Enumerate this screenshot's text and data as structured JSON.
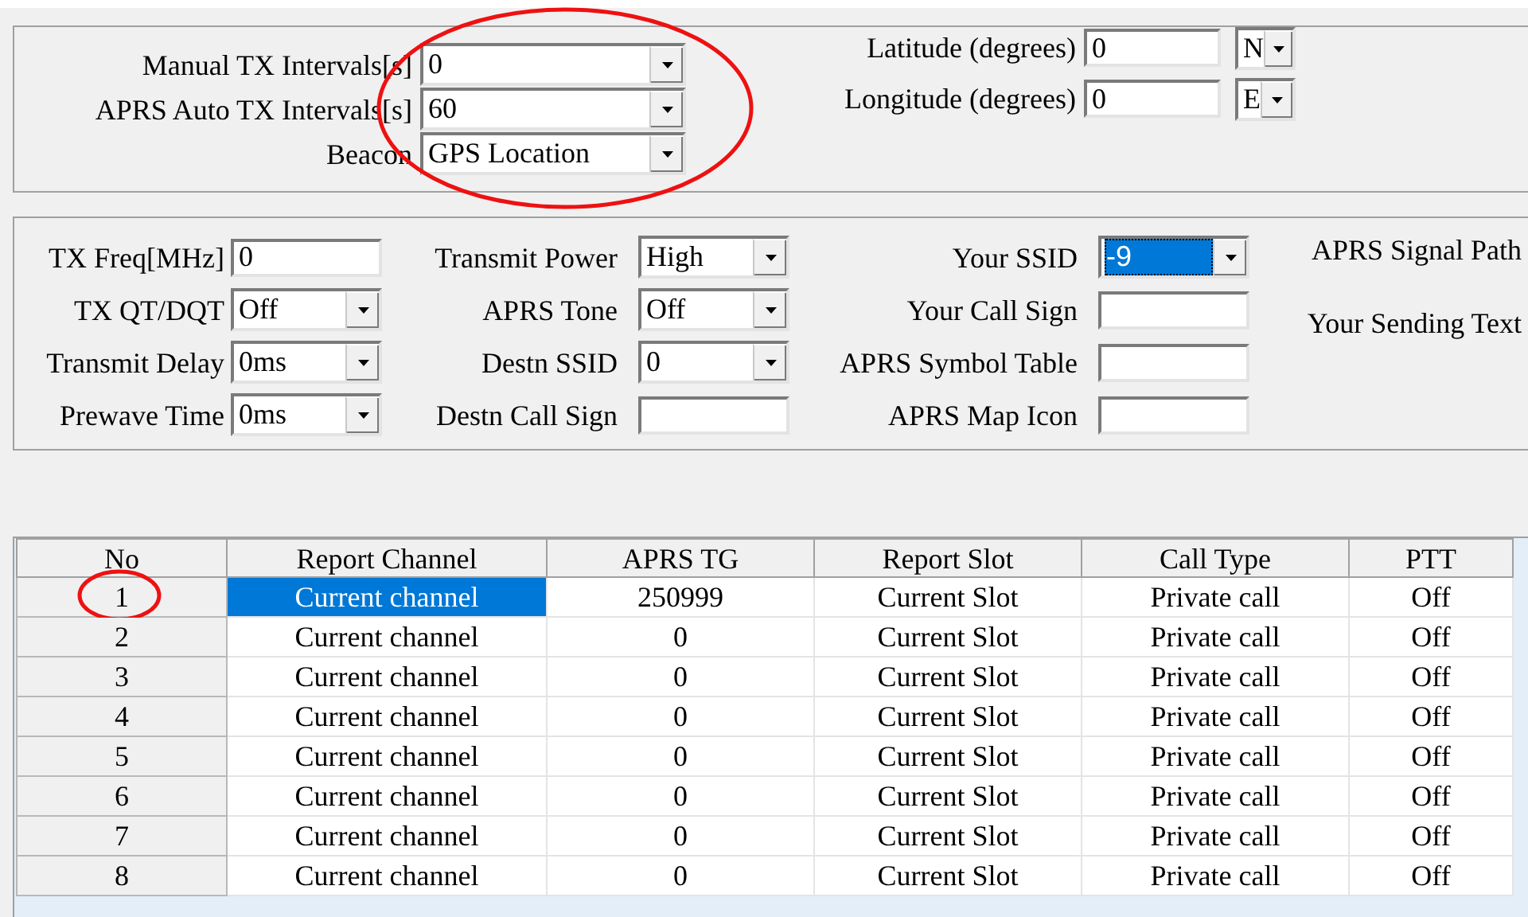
{
  "beacon_panel": {
    "circled": true,
    "rows": [
      {
        "label": "Manual TX Intervals[s]",
        "value": "0"
      },
      {
        "label": "APRS Auto TX Intervals[s]",
        "value": "60"
      },
      {
        "label": "Beacon",
        "value": "GPS Location"
      }
    ],
    "coords": [
      {
        "label": "Latitude (degrees)",
        "value": "0",
        "hemisphere": "N"
      },
      {
        "label": "Longitude (degrees)",
        "value": "0",
        "hemisphere": "E"
      }
    ]
  },
  "settings_panel": {
    "groups": [
      [
        {
          "label": "TX Freq[MHz]",
          "value": "0",
          "kind": "text",
          "focused": false
        },
        {
          "label": "TX QT/DQT",
          "value": "Off",
          "kind": "combo",
          "focused": false
        },
        {
          "label": "Transmit Delay",
          "value": "0ms",
          "kind": "combo",
          "focused": false
        },
        {
          "label": "Prewave Time",
          "value": "0ms",
          "kind": "combo",
          "focused": false
        }
      ],
      [
        {
          "label": "Transmit Power",
          "value": "High",
          "kind": "combo",
          "focused": false
        },
        {
          "label": "APRS Tone",
          "value": "Off",
          "kind": "combo",
          "focused": false
        },
        {
          "label": "Destn SSID",
          "value": "0",
          "kind": "combo",
          "focused": false
        },
        {
          "label": "Destn Call Sign",
          "kind": "text",
          "focused": false
        }
      ],
      [
        {
          "label": "Your SSID",
          "value": "-9",
          "kind": "combo",
          "focused": true
        },
        {
          "label": "Your Call Sign",
          "kind": "text",
          "focused": false
        },
        {
          "label": "APRS Symbol Table",
          "kind": "text",
          "focused": false
        },
        {
          "label": "APRS Map Icon",
          "kind": "text",
          "focused": false
        }
      ]
    ],
    "side_labels": [
      "APRS Signal Path",
      "Your Sending Text"
    ]
  },
  "table": {
    "columns": [
      "No",
      "Report Channel",
      "APRS TG",
      "Report Slot",
      "Call Type",
      "PTT"
    ],
    "rows": [
      {
        "cells": [
          "1",
          "Current channel",
          "250999",
          "Current Slot",
          "Private call",
          "Off"
        ],
        "selected": true,
        "circled": true
      },
      {
        "cells": [
          "2",
          "Current channel",
          "0",
          "Current Slot",
          "Private call",
          "Off"
        ],
        "selected": false,
        "circled": false
      },
      {
        "cells": [
          "3",
          "Current channel",
          "0",
          "Current Slot",
          "Private call",
          "Off"
        ],
        "selected": false,
        "circled": false
      },
      {
        "cells": [
          "4",
          "Current channel",
          "0",
          "Current Slot",
          "Private call",
          "Off"
        ],
        "selected": false,
        "circled": false
      },
      {
        "cells": [
          "5",
          "Current channel",
          "0",
          "Current Slot",
          "Private call",
          "Off"
        ],
        "selected": false,
        "circled": false
      },
      {
        "cells": [
          "6",
          "Current channel",
          "0",
          "Current Slot",
          "Private call",
          "Off"
        ],
        "selected": false,
        "circled": false
      },
      {
        "cells": [
          "7",
          "Current channel",
          "0",
          "Current Slot",
          "Private call",
          "Off"
        ],
        "selected": false,
        "circled": false
      },
      {
        "cells": [
          "8",
          "Current channel",
          "0",
          "Current Slot",
          "Private call",
          "Off"
        ],
        "selected": false,
        "circled": false
      }
    ]
  }
}
